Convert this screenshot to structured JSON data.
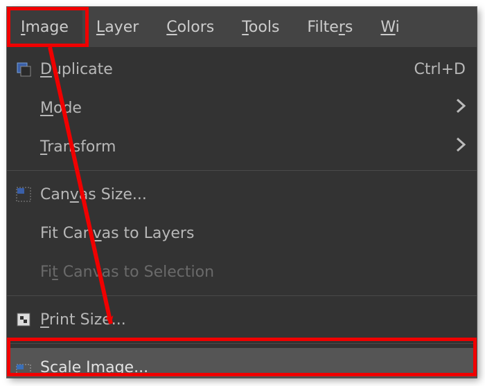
{
  "menubar": {
    "items": [
      {
        "ul": "I",
        "rest": "mage",
        "open": true
      },
      {
        "ul": "L",
        "rest": "ayer"
      },
      {
        "ul": "C",
        "rest": "olors"
      },
      {
        "ul": "T",
        "rest": "ools"
      },
      {
        "ul": "",
        "rest": "Filte",
        "ul2": "r",
        "rest2": "s"
      },
      {
        "ul": "W",
        "rest": "i",
        "cut": true
      }
    ]
  },
  "menu": {
    "duplicate": {
      "ul": "D",
      "rest": "uplicate",
      "accel": "Ctrl+D",
      "icon": "duplicate-icon"
    },
    "mode": {
      "ul": "M",
      "rest": "ode",
      "submenu": true
    },
    "transform": {
      "ul": "T",
      "rest": "ransform",
      "submenu": true
    },
    "canvas_size": {
      "pre": "Can",
      "ul": "v",
      "rest": "as Size...",
      "icon": "canvas-icon"
    },
    "fit_layers": {
      "pre": "Fit Can",
      "ul": "v",
      "rest": "as to Layers"
    },
    "fit_selection": {
      "pre": "Fi",
      "ul": "t",
      "rest": " Canvas to Selection",
      "disabled": true
    },
    "print_size": {
      "ul": "P",
      "rest": "rint Size...",
      "icon": "print-icon"
    },
    "scale_image": {
      "ul": "S",
      "rest": "cale Image...",
      "icon": "scale-icon",
      "hover": true
    }
  },
  "colors": {
    "highlight": "#f00000"
  }
}
